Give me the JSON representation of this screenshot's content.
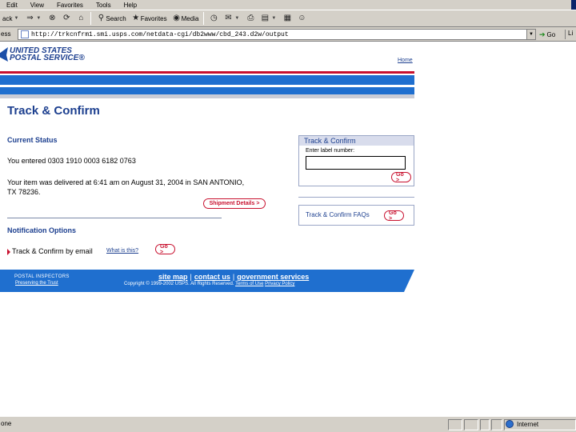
{
  "browser": {
    "menu": [
      "Edit",
      "View",
      "Favorites",
      "Tools",
      "Help"
    ],
    "toolbar": {
      "back": "ack",
      "search": "Search",
      "favorites": "Favorites",
      "media": "Media"
    },
    "address_label": "ess",
    "url": "http://trkcnfrm1.smi.usps.com/netdata-cgi/db2www/cbd_243.d2w/output",
    "go_label": "Go",
    "links_label": "Li",
    "status_text": "one",
    "zone_label": "Internet"
  },
  "page": {
    "logo_line1": "UNITED STATES",
    "logo_line2": "POSTAL SERVICE®",
    "home_link": "Home",
    "title": "Track & Confirm",
    "current_status_heading": "Current Status",
    "entered_text": "You entered 0303 1910 0003 6182 0763",
    "delivered_text_line1": "Your item was delivered at 6:41 am on August 31, 2004 in SAN ANTONIO,",
    "delivered_text_line2": "TX 78236.",
    "shipment_details_button": "Shipment Details >",
    "notification_heading": "Notification Options",
    "notification_link": "Track & Confirm by email",
    "whats_this": "What is this?",
    "go_button": "Go >",
    "sidebar": {
      "box_title": "Track & Confirm",
      "label_caption": "Enter label number:",
      "go_button": "Go >",
      "faqs_label": "Track & Confirm FAQs",
      "faqs_go": "Go >"
    },
    "footer": {
      "inspectors": "POSTAL INSPECTORS",
      "preserving": "Preserving the Trust",
      "nav_site_map": "site map",
      "nav_contact": "contact us",
      "nav_gov": "government services",
      "copyright": "Copyright © 1999-2002 USPS. All Rights Reserved.",
      "terms": "Terms of Use",
      "privacy": "Privacy Policy"
    }
  }
}
